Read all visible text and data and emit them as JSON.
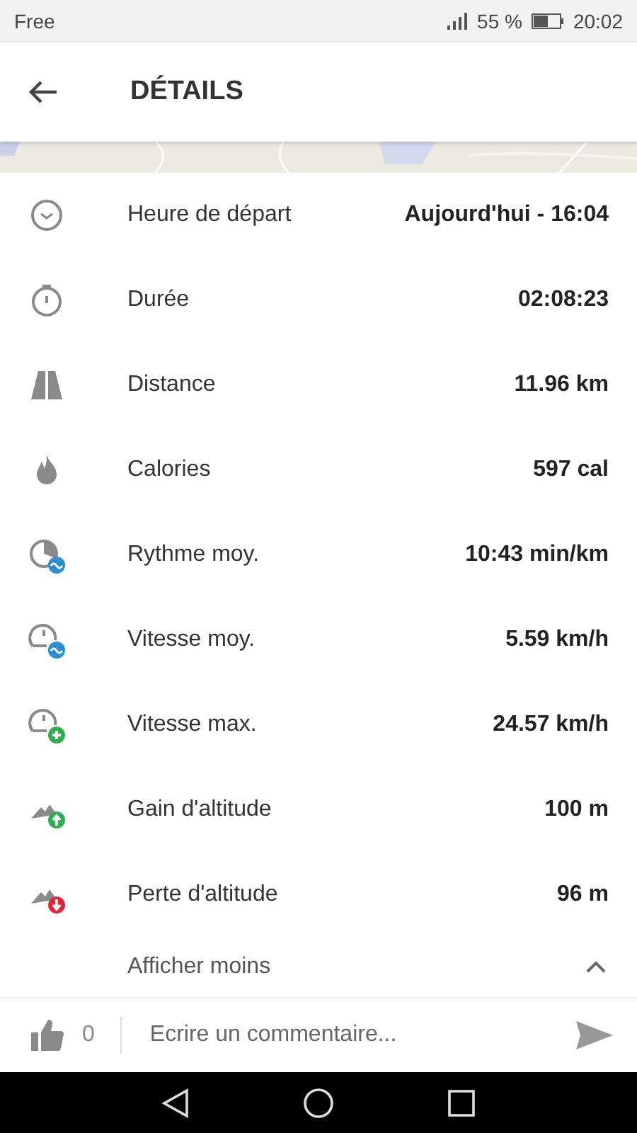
{
  "status_bar": {
    "carrier": "Free",
    "battery": "55 %",
    "time": "20:02"
  },
  "header": {
    "title": "DÉTAILS"
  },
  "stats": [
    {
      "kind": "clock",
      "label": "Heure de départ",
      "value": "Aujourd'hui - 16:04"
    },
    {
      "kind": "stopwatch",
      "label": "Durée",
      "value": "02:08:23"
    },
    {
      "kind": "road",
      "label": "Distance",
      "value": "11.96 km"
    },
    {
      "kind": "flame",
      "label": "Calories",
      "value": "597 cal"
    },
    {
      "kind": "pace",
      "label": "Rythme moy.",
      "value": "10:43 min/km"
    },
    {
      "kind": "speed_avg",
      "label": "Vitesse moy.",
      "value": "5.59 km/h"
    },
    {
      "kind": "speed_max",
      "label": "Vitesse max.",
      "value": "24.57 km/h"
    },
    {
      "kind": "gain",
      "label": "Gain d'altitude",
      "value": "100 m"
    },
    {
      "kind": "loss",
      "label": "Perte d'altitude",
      "value": "96 m"
    }
  ],
  "toggle": {
    "label": "Afficher moins",
    "expanded": true
  },
  "comment_bar": {
    "likes": "0",
    "placeholder": "Ecrire un commentaire..."
  }
}
